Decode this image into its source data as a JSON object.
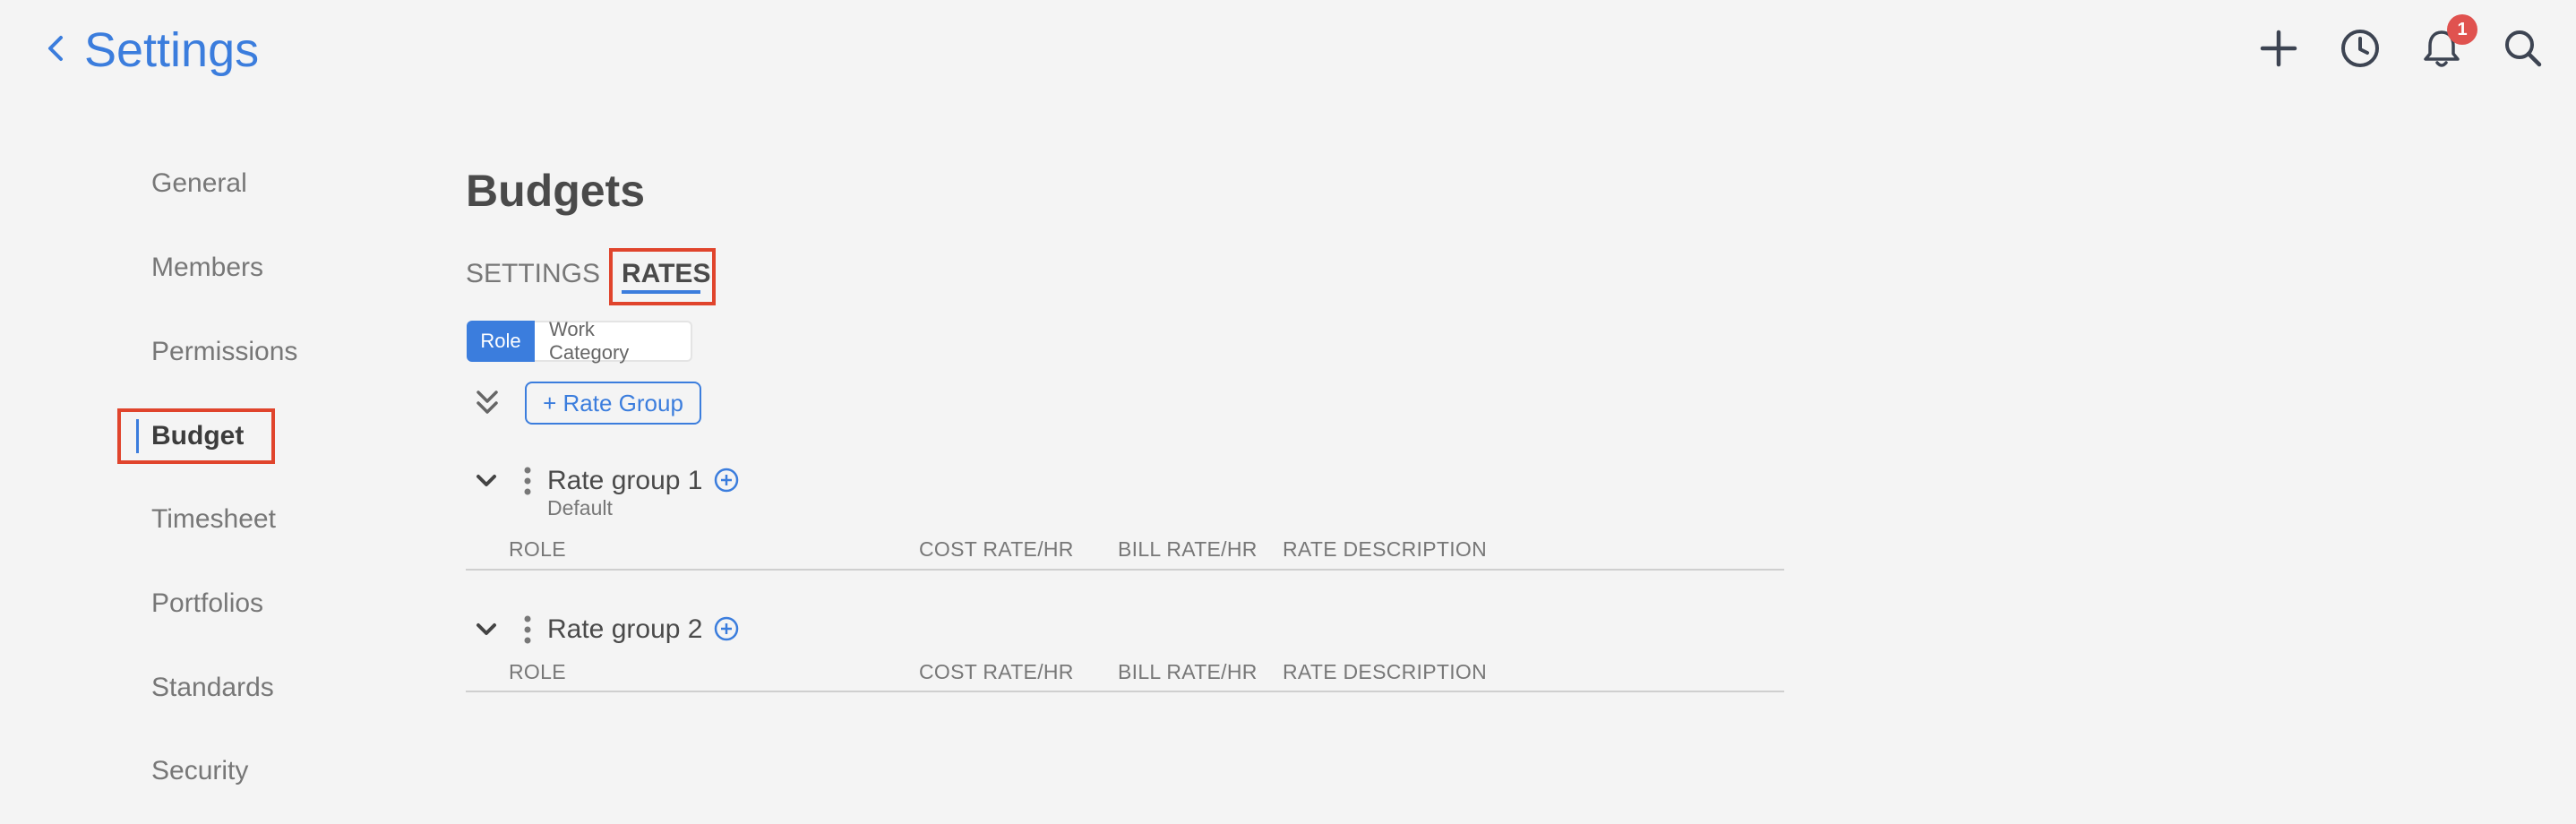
{
  "header": {
    "title": "Settings",
    "icons": [
      "chevron-left-icon",
      "plus-icon",
      "clock-icon",
      "bell-icon",
      "search-icon"
    ],
    "notification_count": "1"
  },
  "sidebar": {
    "items": [
      {
        "label": "General"
      },
      {
        "label": "Members"
      },
      {
        "label": "Permissions"
      },
      {
        "label": "Budget",
        "active": true
      },
      {
        "label": "Timesheet"
      },
      {
        "label": "Portfolios"
      },
      {
        "label": "Standards"
      },
      {
        "label": "Security"
      }
    ]
  },
  "main": {
    "title": "Budgets",
    "tabs": [
      {
        "label": "SETTINGS",
        "active": false
      },
      {
        "label": "RATES",
        "active": true
      }
    ],
    "toggle": {
      "options": [
        "Role",
        "Work Category"
      ],
      "selected": "Role"
    },
    "add_rate_group_label": "+ Rate Group",
    "columns": [
      "ROLE",
      "COST RATE/HR",
      "BILL RATE/HR",
      "RATE DESCRIPTION"
    ],
    "rate_groups": [
      {
        "name": "Rate group 1",
        "subtitle": "Default"
      },
      {
        "name": "Rate group 2"
      }
    ]
  },
  "colors": {
    "accent": "#3b7ddd",
    "highlight": "#e0442c",
    "badge": "#e0524f",
    "background": "#f4f4f4"
  }
}
